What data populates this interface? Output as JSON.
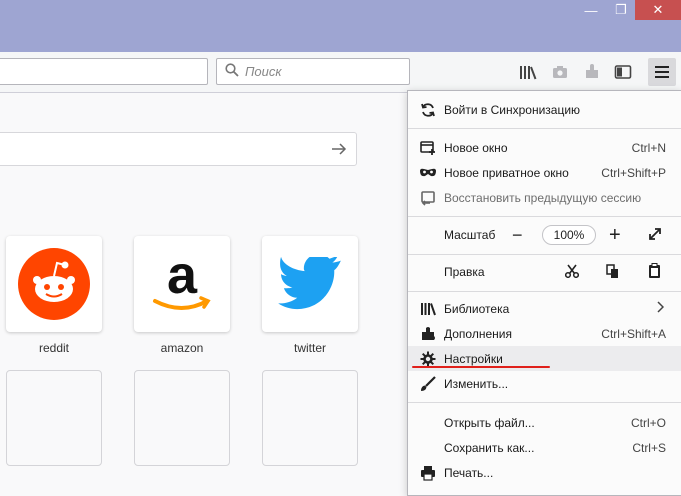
{
  "window": {
    "minimize_glyph": "—",
    "maximize_glyph": "❐",
    "close_glyph": "✕"
  },
  "toolbar": {
    "search_placeholder": "Поиск",
    "icons": [
      "library-icon",
      "screenshot-icon",
      "extension-icon",
      "sidebar-icon",
      "menu-icon"
    ]
  },
  "tiles": [
    {
      "label": "reddit",
      "color": "#ff4500"
    },
    {
      "label": "amazon",
      "color": "#ff9900"
    },
    {
      "label": "twitter",
      "color": "#1da1f2"
    }
  ],
  "menu": {
    "sync": "Войти в Синхронизацию",
    "new_window": {
      "label": "Новое окно",
      "shortcut": "Ctrl+N"
    },
    "new_private": {
      "label": "Новое приватное окно",
      "shortcut": "Ctrl+Shift+P"
    },
    "restore": {
      "label": "Восстановить предыдущую сессию"
    },
    "zoom": {
      "label": "Масштаб",
      "minus": "−",
      "value": "100%",
      "plus": "+"
    },
    "edit": {
      "label": "Правка"
    },
    "library": {
      "label": "Библиотека"
    },
    "addons": {
      "label": "Дополнения",
      "shortcut": "Ctrl+Shift+A"
    },
    "settings": {
      "label": "Настройки"
    },
    "customize": {
      "label": "Изменить..."
    },
    "open_file": {
      "label": "Открыть файл...",
      "shortcut": "Ctrl+O"
    },
    "save_as": {
      "label": "Сохранить как...",
      "shortcut": "Ctrl+S"
    },
    "print": {
      "label": "Печать..."
    }
  },
  "colors": {
    "highlight_underline": "#e0201b"
  }
}
